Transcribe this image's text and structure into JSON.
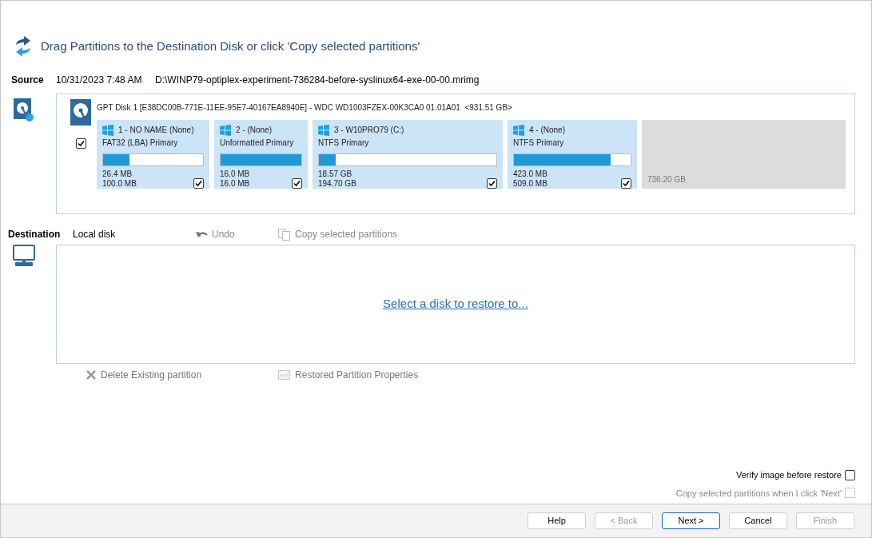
{
  "header": {
    "title": "Drag Partitions to the Destination Disk or click 'Copy selected partitions'"
  },
  "source": {
    "label": "Source",
    "date": "10/31/2023 7:48 AM",
    "path": "D:\\WINP79-optiplex-experiment-736284-before-syslinux64-exe-00-00.mrimg",
    "disk": {
      "title": "GPT Disk 1 [E38DC00B-771E-11EE-95E7-40167EA8940E] - WDC WD1003FZEX-00K3CA0 01.01A01  <931.51 GB>",
      "checked": true,
      "partitions": [
        {
          "kind": "partition",
          "name": "1 - NO NAME (None)",
          "type": "FAT32 (LBA) Primary",
          "level": 0.26,
          "used": "26.4 MB",
          "total": "100.0 MB",
          "checked": true
        },
        {
          "kind": "partition",
          "name": "2 -  (None)",
          "type": "Unformatted Primary",
          "level": 1.0,
          "used": "16.0 MB",
          "total": "16.0 MB",
          "checked": true
        },
        {
          "kind": "partition",
          "name": "3 - W10PRO79 (C:)",
          "type": "NTFS Primary",
          "level": 0.095,
          "used": "18.57 GB",
          "total": "194.70 GB",
          "checked": true
        },
        {
          "kind": "partition",
          "name": "4 -  (None)",
          "type": "NTFS Primary",
          "level": 0.83,
          "used": "423.0 MB",
          "total": "509.0 MB",
          "checked": true
        },
        {
          "kind": "unallocated",
          "total": "736.20 GB"
        }
      ]
    }
  },
  "destination": {
    "label": "Destination",
    "target": "Local disk",
    "undo": {
      "label": "Undo",
      "disabled": true
    },
    "copy": {
      "label": "Copy selected partitions",
      "disabled": true
    },
    "link": "Select a disk to restore to..."
  },
  "tools": [
    {
      "kind": "delete",
      "label": "Delete Existing partition",
      "disabled": true
    },
    {
      "kind": "properties",
      "label": "Restored Partition Properties",
      "disabled": true
    }
  ],
  "options": [
    {
      "label": "Verify image before restore",
      "checked": false,
      "disabled": false
    },
    {
      "label": "Copy selected partitions when I click 'Next'",
      "checked": false,
      "disabled": true
    }
  ],
  "buttons": [
    {
      "label": "Help",
      "disabled": false,
      "selected": false
    },
    {
      "label": "< Back",
      "disabled": true,
      "selected": false
    },
    {
      "label": "Next >",
      "disabled": false,
      "selected": true
    },
    {
      "label": "Cancel",
      "disabled": false,
      "selected": false
    },
    {
      "label": "Finish",
      "disabled": true,
      "selected": false
    }
  ]
}
